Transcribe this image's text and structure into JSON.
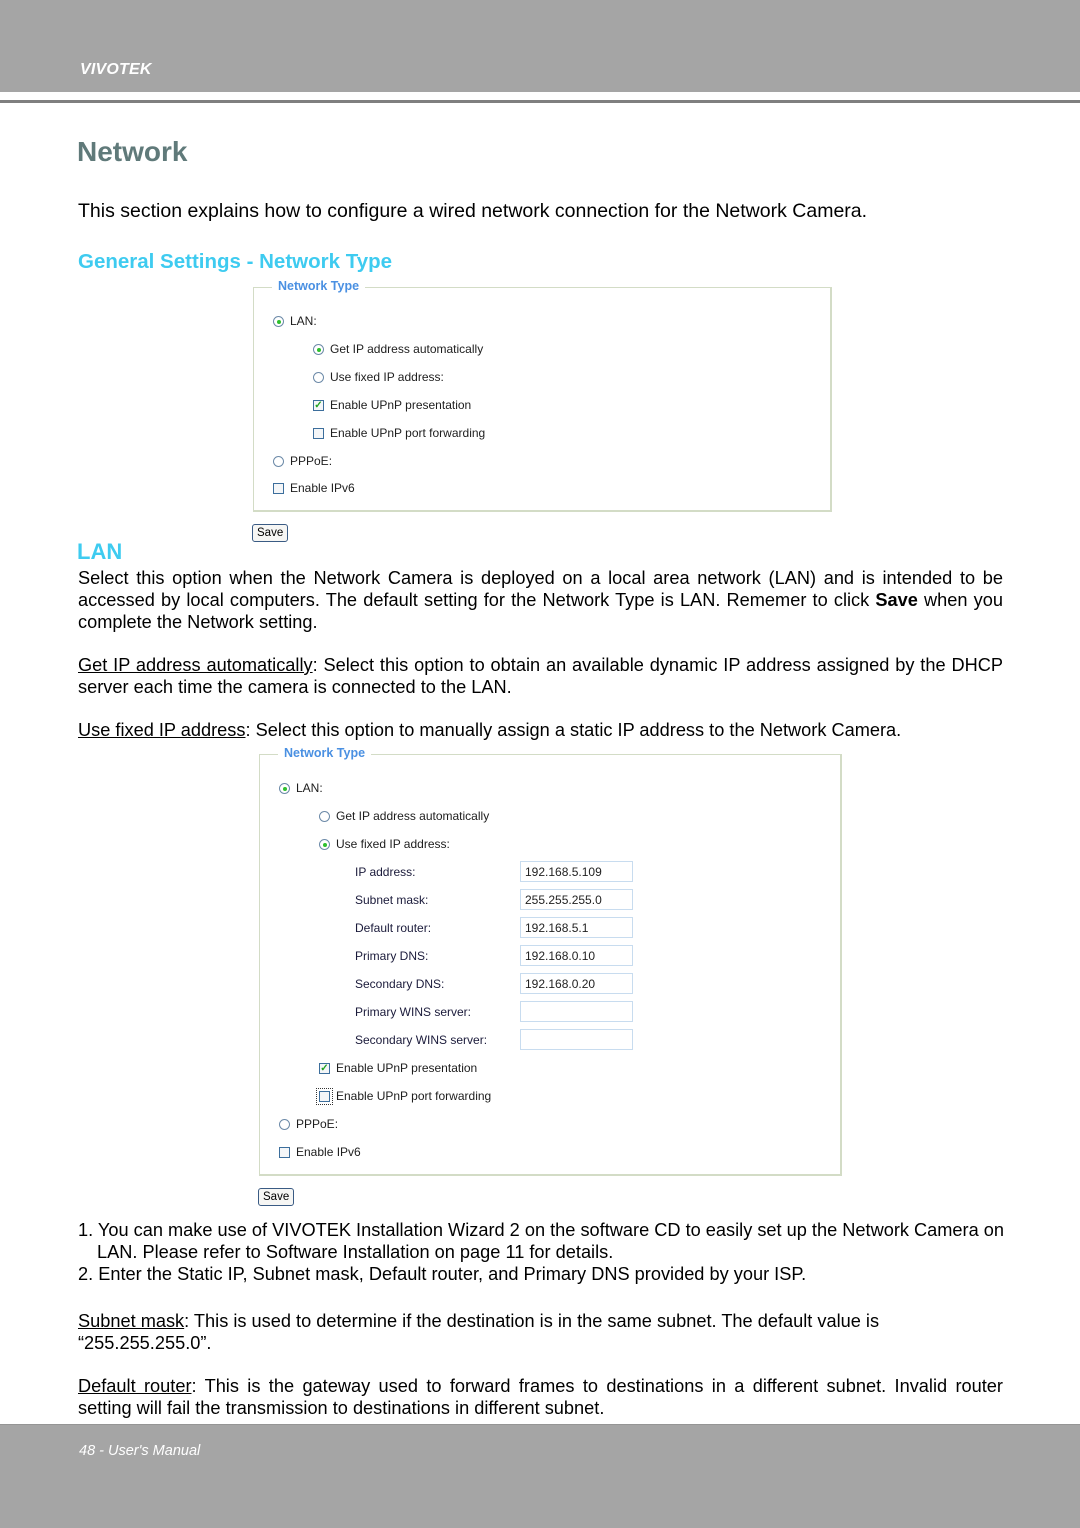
{
  "header": {
    "brand": "VIVOTEK"
  },
  "page": {
    "title": "Network",
    "intro": "This section explains how to configure a wired network connection for the Network Camera.",
    "subhead": "General Settings - Network Type"
  },
  "panel1": {
    "legend": "Network Type",
    "lan": {
      "label": "LAN:",
      "selected": true
    },
    "get_ip_auto": {
      "label": "Get IP address automatically",
      "selected": true
    },
    "use_fixed_ip": {
      "label": "Use fixed IP address:",
      "selected": false
    },
    "upnp_presentation": {
      "label": "Enable UPnP presentation",
      "checked": true
    },
    "upnp_port_forwarding": {
      "label": "Enable UPnP port forwarding",
      "checked": false
    },
    "pppoe": {
      "label": "PPPoE:",
      "selected": false
    },
    "ipv6": {
      "label": "Enable IPv6",
      "checked": false
    },
    "save_label": "Save"
  },
  "lan_section": {
    "heading": "LAN",
    "para1_text": "Select this option when the Network Camera is deployed on a local area network (LAN) and is intended to be accessed by local computers. The default setting for the Network Type is LAN. Rememer to click ",
    "para1_bold": "Save",
    "para1_tail": " when you complete the Network setting.",
    "para2_term": "Get IP address automatically",
    "para2_text": ": Select this option to obtain an available dynamic IP address assigned by the DHCP server each time the camera is connected to the LAN.",
    "para3_term": "Use fixed IP address",
    "para3_text": ": Select this option to manually assign a static IP address to the Network Camera."
  },
  "panel2": {
    "legend": "Network Type",
    "lan": {
      "label": "LAN:",
      "selected": true
    },
    "get_ip_auto": {
      "label": "Get IP address automatically",
      "selected": false
    },
    "use_fixed_ip": {
      "label": "Use fixed IP address:",
      "selected": true
    },
    "fields": [
      {
        "label": "IP address:",
        "value": "192.168.5.109"
      },
      {
        "label": "Subnet mask:",
        "value": "255.255.255.0"
      },
      {
        "label": "Default router:",
        "value": "192.168.5.1"
      },
      {
        "label": "Primary DNS:",
        "value": "192.168.0.10"
      },
      {
        "label": "Secondary DNS:",
        "value": "192.168.0.20"
      },
      {
        "label": "Primary WINS server:",
        "value": ""
      },
      {
        "label": "Secondary WINS server:",
        "value": ""
      }
    ],
    "upnp_presentation": {
      "label": "Enable UPnP presentation",
      "checked": true
    },
    "upnp_port_forwarding": {
      "label": "Enable UPnP port forwarding",
      "checked": false
    },
    "pppoe": {
      "label": "PPPoE:",
      "selected": false
    },
    "ipv6": {
      "label": "Enable IPv6",
      "checked": false
    },
    "save_label": "Save"
  },
  "steps": [
    "1. You can make use of VIVOTEK Installation Wizard 2 on the software CD to easily set up the Network Camera on LAN. Please refer to Software Installation on page 11 for details.",
    "2. Enter the Static IP, Subnet mask, Default router, and Primary DNS provided by your ISP."
  ],
  "subnet_para": {
    "term": "Subnet mask",
    "text": ": This is used to determine if the destination is in the same subnet. The default value is “255.255.255.0”."
  },
  "router_para": {
    "term": "Default router",
    "text": ": This is the gateway used to forward frames to destinations in a different subnet. Invalid router setting will fail the transmission to destinations in different subnet."
  },
  "footer": {
    "text": "48 - User's Manual"
  }
}
